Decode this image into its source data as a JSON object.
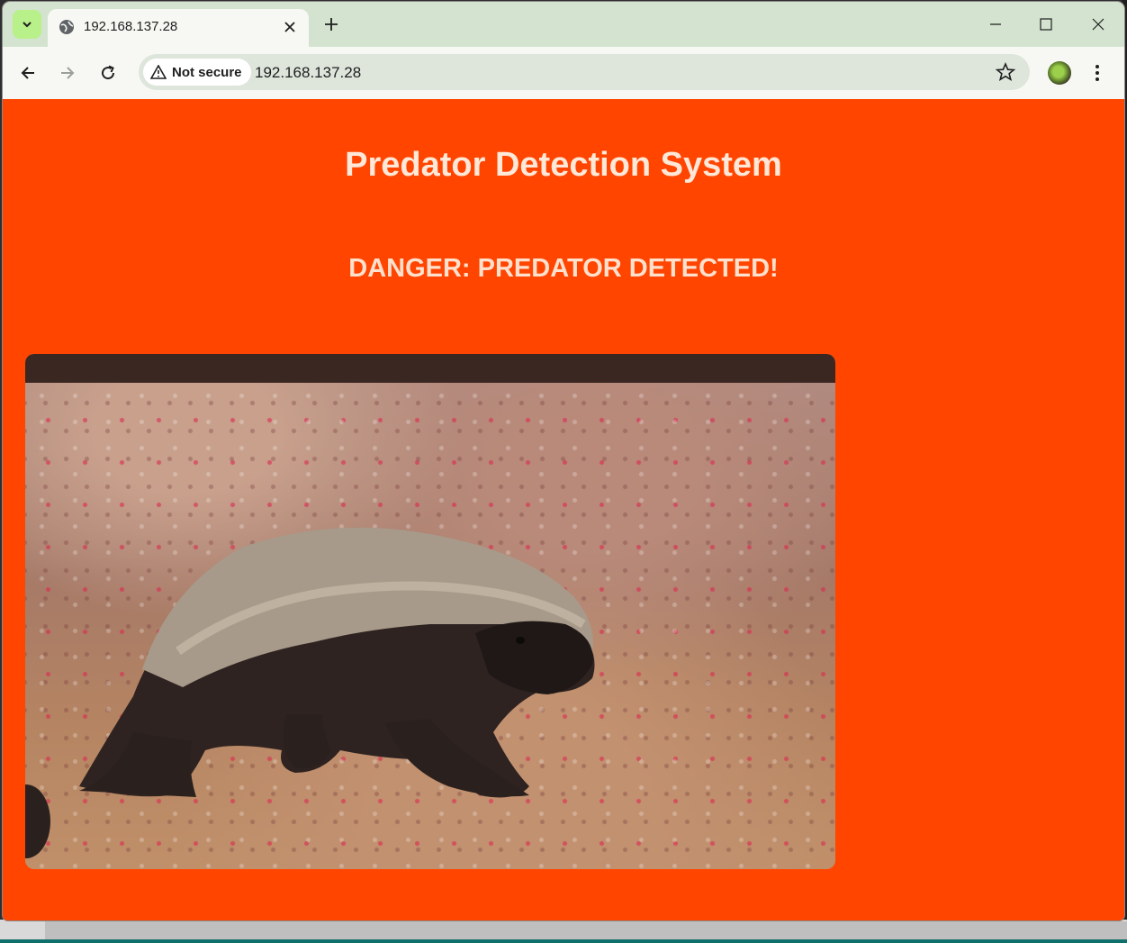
{
  "browser": {
    "tab_title": "192.168.137.28",
    "security_label": "Not secure",
    "url": "192.168.137.28",
    "icons": {
      "tab_search": "chevron-down-icon",
      "tab": "globe-icon",
      "close": "close-icon",
      "new_tab": "plus-icon",
      "minimize": "minimize-icon",
      "maximize": "maximize-icon",
      "window_close": "close-icon",
      "back": "arrow-left-icon",
      "forward": "arrow-right-icon",
      "reload": "reload-icon",
      "warning": "warning-icon",
      "bookmark": "star-icon",
      "menu": "more-vertical-icon"
    }
  },
  "page": {
    "title": "Predator Detection System",
    "status": "DANGER: PREDATOR DETECTED!",
    "background_color": "#ff4500",
    "feed_image_description_icon": "camera-feed-image"
  }
}
